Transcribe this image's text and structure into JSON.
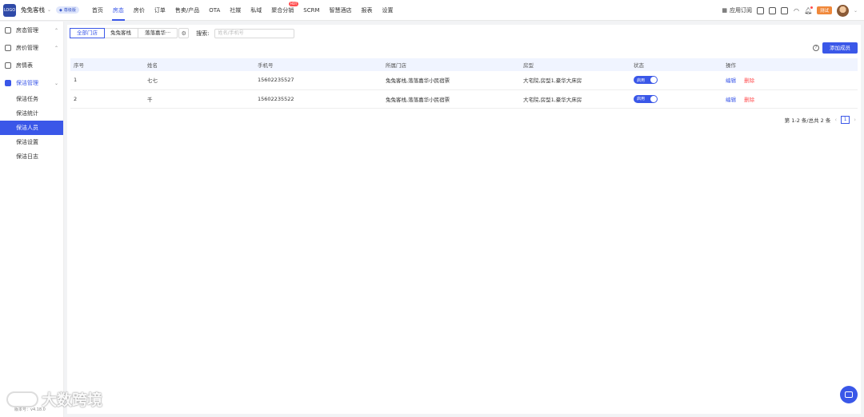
{
  "app": {
    "name": "兔兔客栈",
    "vip_label": "尊级版",
    "logo_text": "LOGO"
  },
  "nav": {
    "items": [
      {
        "label": "首页",
        "active": false
      },
      {
        "label": "房态",
        "active": true
      },
      {
        "label": "房价",
        "active": false
      },
      {
        "label": "订单",
        "active": false
      },
      {
        "label": "售卖/产品",
        "active": false
      },
      {
        "label": "OTA",
        "active": false
      },
      {
        "label": "社媒",
        "active": false
      },
      {
        "label": "私域",
        "active": false
      },
      {
        "label": "聚合分销",
        "active": false,
        "badge": "HOT"
      },
      {
        "label": "SCRM",
        "active": false
      },
      {
        "label": "智慧酒店",
        "active": false
      },
      {
        "label": "报表",
        "active": false
      },
      {
        "label": "设置",
        "active": false
      }
    ]
  },
  "top_right": {
    "app_subscribe": "应用订阅",
    "test_badge": "测试"
  },
  "sidebar": {
    "groups": [
      {
        "label": "房态管理",
        "arrow": "⌃"
      },
      {
        "label": "房价管理",
        "arrow": "⌃"
      },
      {
        "label": "房情表"
      },
      {
        "label": "保洁管理",
        "arrow": "⌄",
        "open": true
      }
    ],
    "sub_items": [
      {
        "label": "保洁任务",
        "active": false
      },
      {
        "label": "保洁统计",
        "active": false
      },
      {
        "label": "保洁人员",
        "active": true
      },
      {
        "label": "保洁设置",
        "active": false
      },
      {
        "label": "保洁日志",
        "active": false
      }
    ],
    "version": "版本号：v4.18.0"
  },
  "filters": {
    "segments": [
      "全部门店",
      "兔兔客栈",
      "落落嘉华···"
    ],
    "search_label": "搜索:",
    "search_placeholder": "姓名/手机号",
    "search_value": ""
  },
  "actions": {
    "add_member": "添加成员"
  },
  "table": {
    "headers": [
      "序号",
      "姓名",
      "手机号",
      "所属门店",
      "房型",
      "状态",
      "操作"
    ],
    "rows": [
      {
        "idx": "1",
        "name": "七七",
        "phone": "15602235527",
        "store": "兔兔客栈,落落嘉华小民宿票",
        "room": "大宅院,房型1,豪华大床房",
        "status": "启用",
        "edit": "编辑",
        "delete": "删除"
      },
      {
        "idx": "2",
        "name": "千",
        "phone": "15602235522",
        "store": "兔兔客栈,落落嘉华小民宿票",
        "room": "大宅院,房型1,豪华大床房",
        "status": "启用",
        "edit": "编辑",
        "delete": "删除"
      }
    ]
  },
  "pagination": {
    "summary": "第 1-2 条/总共 2 条",
    "current": "1"
  },
  "watermark": "大数跨境",
  "colors": {
    "primary": "#3a57e8",
    "danger": "#ff4d4f",
    "test_badge": "#f0883a"
  }
}
